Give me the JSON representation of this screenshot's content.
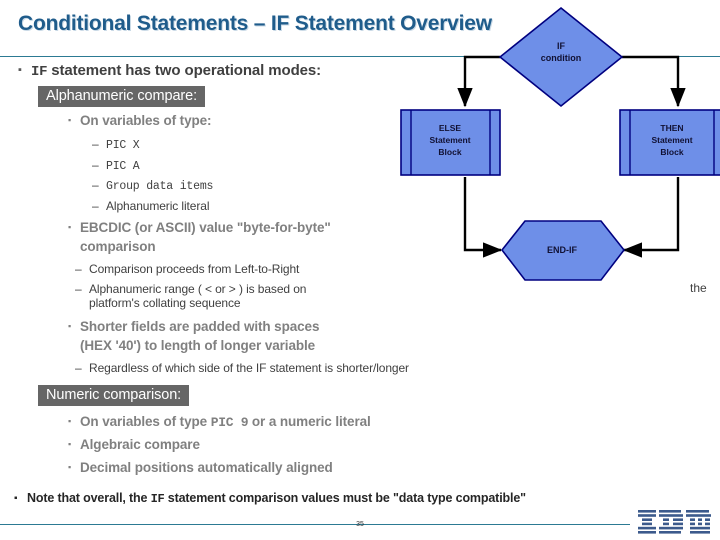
{
  "slide": {
    "title": "Conditional Statements – IF Statement Overview",
    "page_number": "35"
  },
  "body": {
    "intro": {
      "marker": "▪",
      "mono": "IF",
      "text": " statement has two operational modes:"
    },
    "alpha_banner": "Alphanumeric compare:",
    "alpha": {
      "on_variables": {
        "marker": "▪",
        "text": "On variables of type:"
      },
      "types": [
        {
          "marker": "–",
          "mono": "PIC X",
          "text": ""
        },
        {
          "marker": "–",
          "mono": "PIC A",
          "text": ""
        },
        {
          "marker": "–",
          "mono": "Group data items",
          "text": ""
        },
        {
          "marker": "–",
          "mono": "",
          "text": "Alphanumeric literal"
        }
      ],
      "ebcdic": {
        "marker": "▪",
        "line1": "EBCDIC (or ASCII) value \"byte-for-byte\"",
        "line2": "comparison"
      },
      "ebcdic_subs": [
        {
          "marker": "–",
          "text": "Comparison proceeds from Left-to-Right"
        },
        {
          "marker": "–",
          "line1": "Alphanumeric range ( <  or  > ) is based on",
          "line2": "platform's collating sequence"
        }
      ],
      "padding": {
        "marker": "▪",
        "line1": "Shorter fields are padded with spaces",
        "line2": "(HEX '40') to length of longer variable"
      },
      "padding_sub": {
        "marker": "–",
        "text": "Regardless of which side of the IF statement is shorter/longer"
      }
    },
    "numeric_banner": "Numeric comparison:",
    "numeric": [
      {
        "marker": "▪",
        "pre": "On variables of type ",
        "mono": "PIC  9",
        "post": " or a numeric literal"
      },
      {
        "marker": "▪",
        "pre": "Algebraic compare",
        "mono": "",
        "post": ""
      },
      {
        "marker": "▪",
        "pre": "Decimal positions automatically aligned",
        "mono": "",
        "post": ""
      }
    ],
    "note": {
      "marker": "▪",
      "pre": "Note that overall, the ",
      "mono": "IF",
      "post": " statement comparison values must be \"data type compatible\""
    },
    "orphan_text": "the"
  },
  "flowchart": {
    "shape_fill": "#6E8FE8",
    "shape_stroke": "#000080",
    "arrow_color": "#000000",
    "nodes": [
      {
        "id": "if-condition",
        "shape": "diamond",
        "line1": "IF",
        "line2": "condition"
      },
      {
        "id": "else-block",
        "shape": "predefined-process",
        "line1": "ELSE",
        "line2": "Statement",
        "line3": "Block"
      },
      {
        "id": "then-block",
        "shape": "predefined-process",
        "line1": "THEN",
        "line2": "Statement",
        "line3": "Block"
      },
      {
        "id": "end-if",
        "shape": "hexagon",
        "line1": "END-IF"
      }
    ]
  },
  "footer": {
    "logo_name": "IBM",
    "logo_color": "#3C5A8C"
  }
}
